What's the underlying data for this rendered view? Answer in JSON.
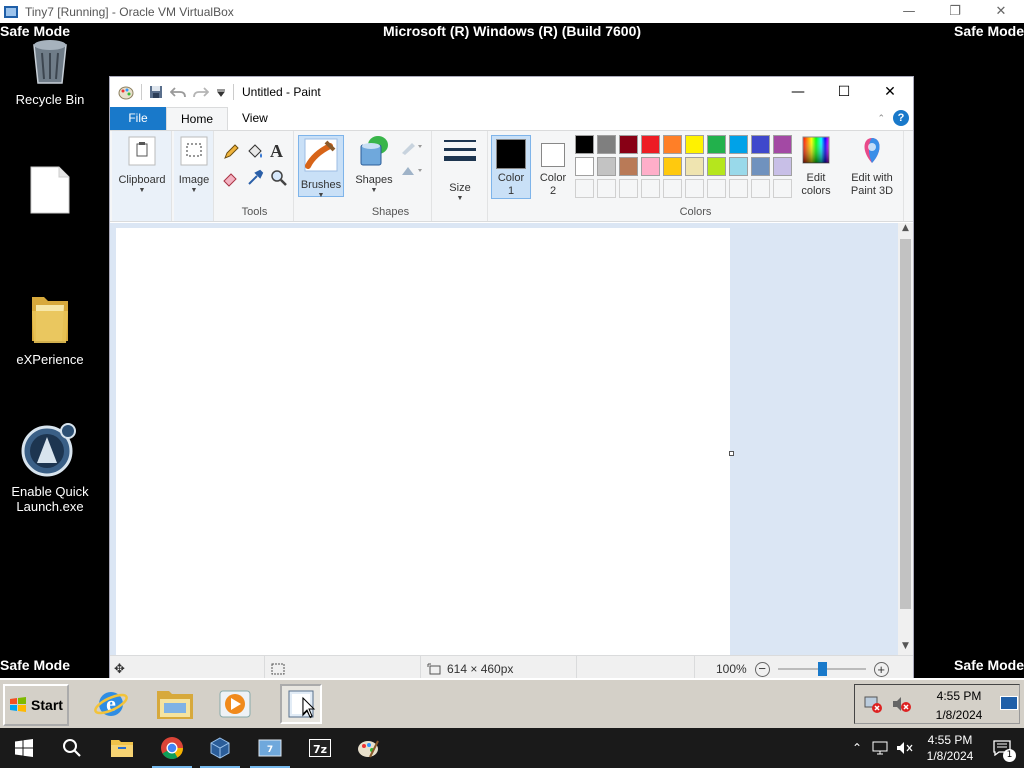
{
  "host_window": {
    "title": "Tiny7 [Running] - Oracle VM VirtualBox",
    "controls": [
      "minimize",
      "restore",
      "close"
    ]
  },
  "guest": {
    "safe_mode_label": "Safe Mode",
    "build_label": "Microsoft (R) Windows (R) (Build 7600)",
    "desktop_icons": [
      {
        "label": "Recycle Bin",
        "icon": "recycle-bin-icon"
      },
      {
        "label": "",
        "icon": "blank-file-icon"
      },
      {
        "label": "eXPerience",
        "icon": "folder-icon"
      },
      {
        "label": "Enable Quick Launch.exe",
        "icon": "quick-launch-app-icon"
      }
    ]
  },
  "paint": {
    "title": "Untitled - Paint",
    "tabs": {
      "file": "File",
      "home": "Home",
      "view": "View"
    },
    "ribbon": {
      "clipboard": "Clipboard",
      "image": "Image",
      "tools": "Tools",
      "brushes": "Brushes",
      "shapes_button": "Shapes",
      "shapes_group": "Shapes",
      "size": "Size",
      "color1_line1": "Color",
      "color1_line2": "1",
      "color2_line1": "Color",
      "color2_line2": "2",
      "edit_colors_line1": "Edit",
      "edit_colors_line2": "colors",
      "edit3d_line1": "Edit with",
      "edit3d_line2": "Paint 3D",
      "colors_group": "Colors"
    },
    "palette_row1": [
      "#000000",
      "#7f7f7f",
      "#880015",
      "#ed1c24",
      "#ff7f27",
      "#fff200",
      "#22b14c",
      "#00a2e8",
      "#3f48cc",
      "#a349a4"
    ],
    "palette_row2": [
      "#ffffff",
      "#c3c3c3",
      "#b97a57",
      "#ffaec9",
      "#ffc90e",
      "#efe4b0",
      "#b5e61d",
      "#99d9ea",
      "#7092be",
      "#c8bfe7"
    ],
    "color1": "#000000",
    "color2": "#ffffff",
    "status": {
      "dimensions": "614 × 460px",
      "zoom": "100%"
    }
  },
  "guest_taskbar": {
    "start_label": "Start",
    "time": "4:55 PM",
    "date": "1/8/2024"
  },
  "host_taskbar": {
    "time": "4:55 PM",
    "date": "1/8/2024",
    "notification_count": "1"
  }
}
